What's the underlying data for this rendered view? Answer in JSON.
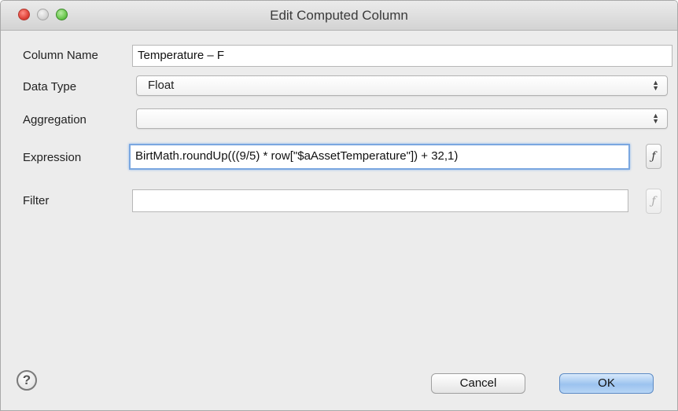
{
  "window": {
    "title": "Edit Computed Column"
  },
  "fields": {
    "column_name_label": "Column Name",
    "column_name_value": "Temperature – F",
    "data_type_label": "Data Type",
    "data_type_value": "Float",
    "aggregation_label": "Aggregation",
    "aggregation_value": "",
    "expression_label": "Expression",
    "expression_value": "BirtMath.roundUp(((9/5) * row[\"$aAssetTemperature\"]) + 32,1)",
    "filter_label": "Filter",
    "filter_value": ""
  },
  "icons": {
    "expression_builder": "ƒ",
    "help": "?",
    "select_arrows": "⬍"
  },
  "footer": {
    "cancel_label": "Cancel",
    "ok_label": "OK"
  },
  "colors": {
    "focus_ring": "#7aa7e0",
    "default_button": "#9cc3ef",
    "close_button": "#e0443a",
    "zoom_button": "#6cc84f"
  }
}
